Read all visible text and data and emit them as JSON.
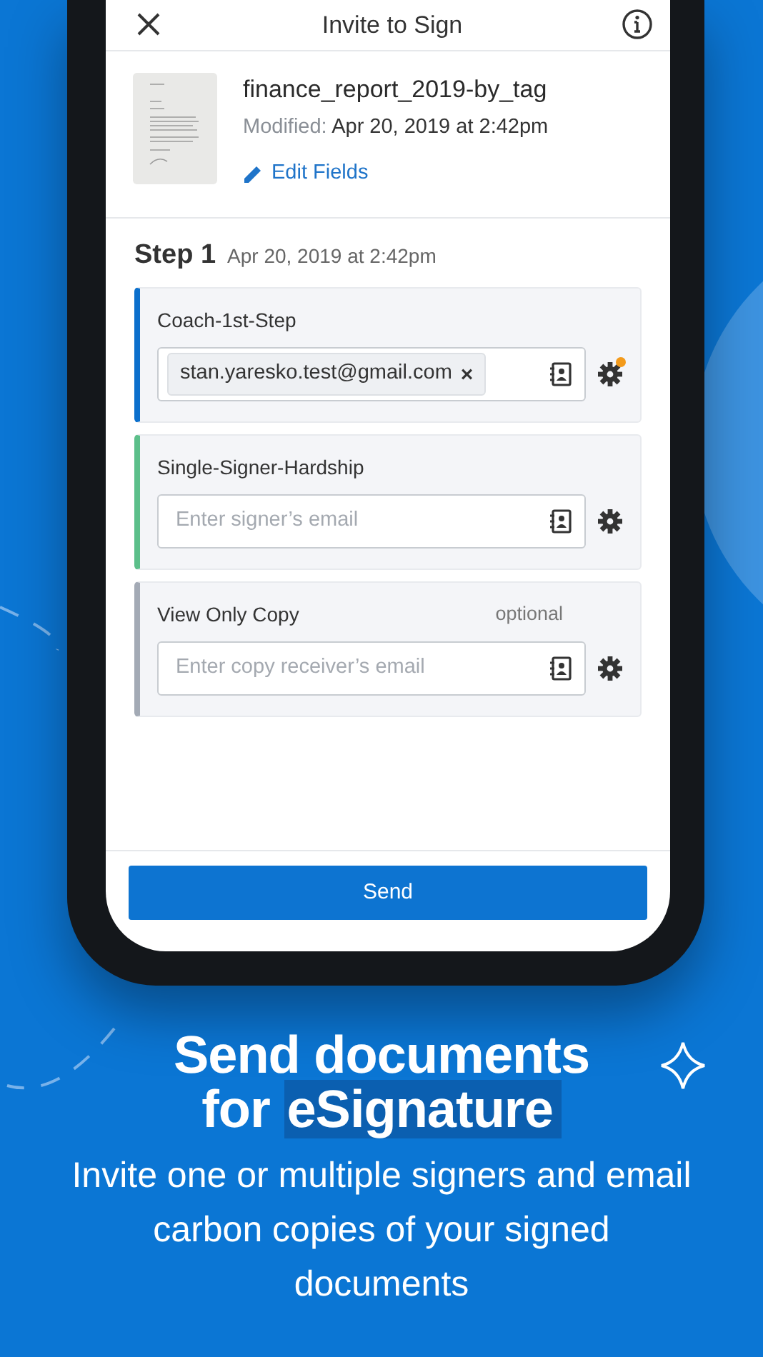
{
  "header": {
    "title": "Invite to Sign"
  },
  "document": {
    "name": "finance_report_2019-by_tag",
    "modified_label": "Modified:",
    "modified": "Apr 20, 2019 at 2:42pm",
    "edit_link": "Edit Fields"
  },
  "step": {
    "title": "Step 1",
    "date": "Apr 20, 2019 at 2:42pm"
  },
  "roles": [
    {
      "name": "Coach-1st-Step",
      "color": "#0b6fcc",
      "kind": "recipient",
      "recipient": "stan.yaresko.test@gmail.com",
      "remove": "×",
      "settings_badge": true
    },
    {
      "name": "Single-Signer-Hardship",
      "color": "#5cbf8a",
      "kind": "empty",
      "placeholder": "Enter signer’s email",
      "settings_badge": false
    },
    {
      "name": "View Only Copy",
      "color": "#a3aab5",
      "kind": "empty",
      "optional": "optional",
      "placeholder": "Enter copy receiver’s email",
      "settings_badge": false
    }
  ],
  "send_button": "Send",
  "promo": {
    "heading": "Send documents for",
    "heading_highlight": "eSignature",
    "text": "Invite one or multiple signers and email carbon copies of your signed documents"
  }
}
